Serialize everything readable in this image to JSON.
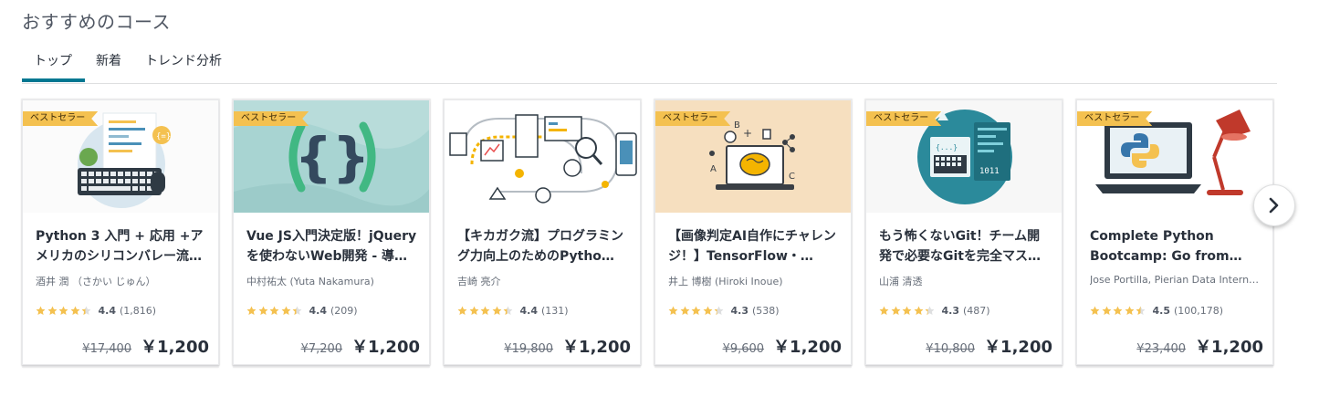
{
  "section_title": "おすすめのコース",
  "tabs": [
    {
      "label": "トップ"
    },
    {
      "label": "新着"
    },
    {
      "label": "トレンド分析"
    }
  ],
  "badge_label": "ベストセラー",
  "colors": {
    "accent": "#007791",
    "star": "#f4c150",
    "badge": "#f4c150"
  },
  "courses": [
    {
      "title": "Python 3 入門 + 応用 +アメリカのシリコンバレー流…",
      "author": "酒井 潤 （さかい じゅん）",
      "rating": "4.4",
      "stars": 4.4,
      "count": "(1,816)",
      "old_price": "¥17,400",
      "price": "￥1,200",
      "bestseller": true
    },
    {
      "title": "Vue JS入門決定版！jQueryを使わないWeb開発 - 導…",
      "author": "中村祐太 (Yuta Nakamura)",
      "rating": "4.4",
      "stars": 4.4,
      "count": "(209)",
      "old_price": "¥7,200",
      "price": "￥1,200",
      "bestseller": true
    },
    {
      "title": "【キカガク流】プログラミング力向上のためのPytho…",
      "author": "吉崎 亮介",
      "rating": "4.4",
      "stars": 4.4,
      "count": "(131)",
      "old_price": "¥19,800",
      "price": "￥1,200",
      "bestseller": false
    },
    {
      "title": "【画像判定AI自作にチャレンジ！】TensorFlow・…",
      "author": "井上 博樹 (Hiroki Inoue)",
      "rating": "4.3",
      "stars": 4.3,
      "count": "(538)",
      "old_price": "¥9,600",
      "price": "￥1,200",
      "bestseller": true
    },
    {
      "title": "もう怖くないGit！チーム開発で必要なGitを完全マス…",
      "author": "山浦 清透",
      "rating": "4.3",
      "stars": 4.3,
      "count": "(487)",
      "old_price": "¥10,800",
      "price": "￥1,200",
      "bestseller": true
    },
    {
      "title": "Complete Python Bootcamp: Go from zero…",
      "author": "Jose Portilla, Pierian Data Intern…",
      "rating": "4.5",
      "stars": 4.5,
      "count": "(100,178)",
      "old_price": "¥23,400",
      "price": "￥1,200",
      "bestseller": true
    }
  ],
  "icons": {
    "next": "chevron-right-icon",
    "star": "star-icon"
  }
}
